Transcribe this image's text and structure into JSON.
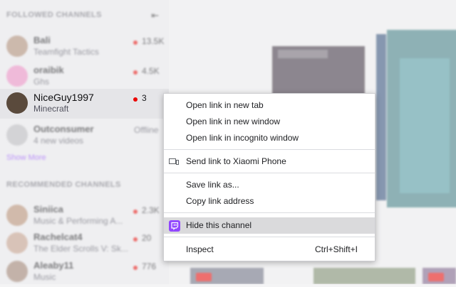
{
  "sidebar": {
    "followed_header": "FOLLOWED CHANNELS",
    "collapse_icon": "collapse-arrow-icon",
    "followed": [
      {
        "name": "Bali",
        "game": "Teamfight Tactics",
        "count": "13.5K",
        "live": true,
        "avatar_color": "#b08d75"
      },
      {
        "name": "oraibik",
        "game": "Ghs",
        "count": "4.5K",
        "live": true,
        "avatar_color": "#f08fc6"
      },
      {
        "name": "NiceGuy1997",
        "game": "Minecraft",
        "count": "3",
        "live": true,
        "avatar_color": "#5a4a3c"
      },
      {
        "name": "Outconsumer",
        "game": "4 new videos",
        "count": "Offline",
        "live": false,
        "avatar_color": "#bdbdc0"
      }
    ],
    "show_more": "Show More",
    "recommended_header": "RECOMMENDED CHANNELS",
    "recommended": [
      {
        "name": "Siniica",
        "game": "Music & Performing A...",
        "count": "2.3K",
        "live": true,
        "avatar_color": "#b98f72"
      },
      {
        "name": "Rachelcat4",
        "game": "The Elder Scrolls V: Sk...",
        "count": "20",
        "live": true,
        "avatar_color": "#c7a08a"
      },
      {
        "name": "Aleaby11",
        "game": "Music",
        "count": "776",
        "live": true,
        "avatar_color": "#a08270"
      }
    ]
  },
  "main": {
    "fragment_label": "l",
    "live_badge": "LIVE"
  },
  "context_menu": {
    "groups": [
      [
        {
          "label": "Open link in new tab"
        },
        {
          "label": "Open link in new window"
        },
        {
          "label": "Open link in incognito window"
        }
      ],
      [
        {
          "label": "Send link to Xiaomi Phone",
          "icon": "device-send-icon"
        }
      ],
      [
        {
          "label": "Save link as..."
        },
        {
          "label": "Copy link address"
        }
      ],
      [
        {
          "label": "Hide this channel",
          "icon": "twitch-icon",
          "highlighted": true
        }
      ],
      [
        {
          "label": "Inspect",
          "shortcut": "Ctrl+Shift+I"
        }
      ]
    ]
  },
  "colors": {
    "live_dot": "#eb0400",
    "twitch_purple": "#9146ff",
    "menu_highlight": "#dadadc"
  }
}
